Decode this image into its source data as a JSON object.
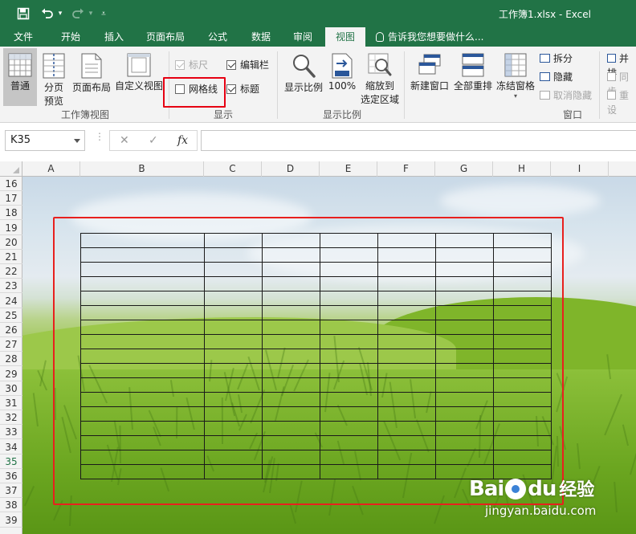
{
  "window": {
    "title": "工作簿1.xlsx - Excel"
  },
  "qat": {
    "save_icon": "save-icon",
    "undo_icon": "undo-icon",
    "redo_icon": "redo-icon",
    "customize_icon": "customize-qat-icon"
  },
  "tabs": [
    {
      "label": "文件",
      "active": false
    },
    {
      "label": "开始",
      "active": false
    },
    {
      "label": "插入",
      "active": false
    },
    {
      "label": "页面布局",
      "active": false
    },
    {
      "label": "公式",
      "active": false
    },
    {
      "label": "数据",
      "active": false
    },
    {
      "label": "审阅",
      "active": false
    },
    {
      "label": "视图",
      "active": true
    }
  ],
  "tell_me": {
    "placeholder": "告诉我您想要做什么..."
  },
  "ribbon": {
    "workbook_views": {
      "label": "工作簿视图",
      "normal": "普通",
      "page_break_1": "分页",
      "page_break_2": "预览",
      "page_layout": "页面布局",
      "custom_views": "自定义视图"
    },
    "show": {
      "label": "显示",
      "ruler": {
        "label": "标尺",
        "checked": true,
        "disabled": true
      },
      "formula_bar": {
        "label": "编辑栏",
        "checked": true
      },
      "gridlines": {
        "label": "网格线",
        "checked": false
      },
      "headings": {
        "label": "标题",
        "checked": true
      }
    },
    "zoom": {
      "label": "显示比例",
      "zoom": "显示比例",
      "hundred": "100%",
      "zoom_to_selection_1": "缩放到",
      "zoom_to_selection_2": "选定区域"
    },
    "window": {
      "label": "窗口",
      "new_window": "新建窗口",
      "arrange_all": "全部重排",
      "freeze_panes": "冻结窗格",
      "split": "拆分",
      "hide": "隐藏",
      "unhide": "取消隐藏",
      "side_by_side": "并排",
      "sync_scroll": "同步",
      "reset_position": "重设"
    }
  },
  "formula_bar": {
    "name_box": "K35",
    "cancel": "✕",
    "enter": "✓",
    "fx": "fx",
    "value": ""
  },
  "sheet": {
    "columns": [
      "A",
      "B",
      "C",
      "D",
      "E",
      "F",
      "G",
      "H",
      "I"
    ],
    "rows": [
      "16",
      "17",
      "18",
      "19",
      "20",
      "21",
      "22",
      "23",
      "24",
      "25",
      "26",
      "27",
      "28",
      "29",
      "30",
      "31",
      "32",
      "33",
      "34",
      "35",
      "36",
      "37",
      "38",
      "39"
    ],
    "active_row": "35",
    "drawn_table": {
      "rows": 17,
      "cols": 7
    }
  },
  "watermark": {
    "brand_a": "Bai",
    "brand_b": "du",
    "cn": "经验",
    "url": "jingyan.baidu.com"
  }
}
